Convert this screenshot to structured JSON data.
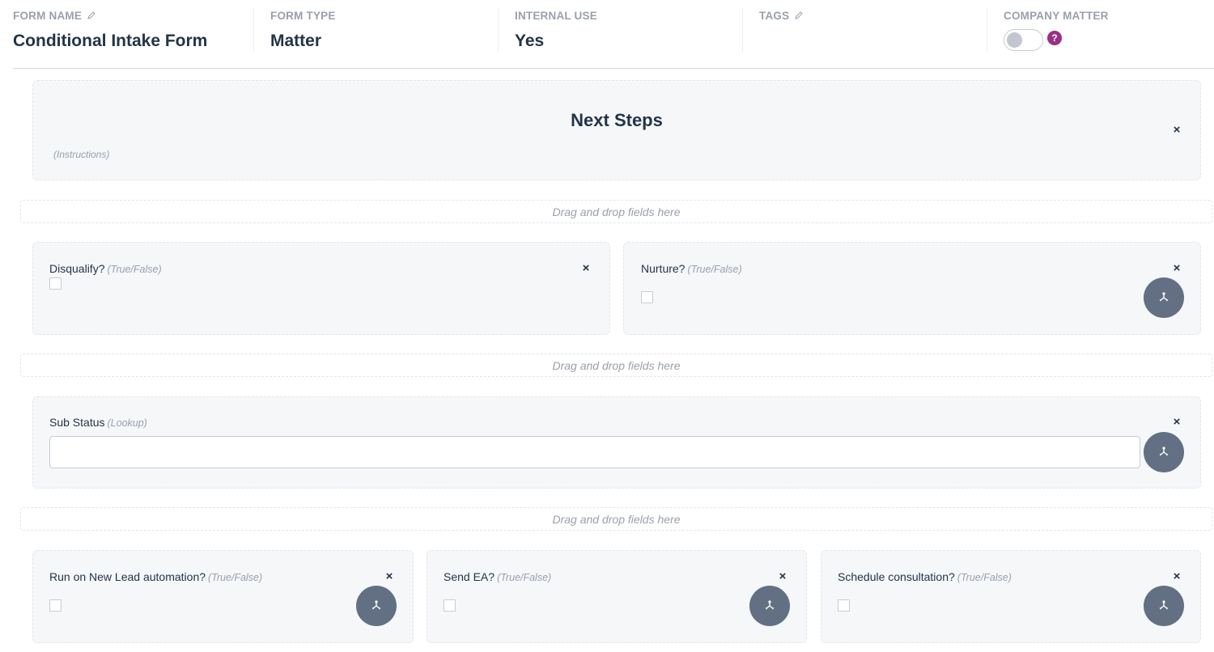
{
  "header": {
    "columns": [
      {
        "label": "FORM NAME",
        "value": "Conditional Intake Form",
        "editable": true
      },
      {
        "label": "FORM TYPE",
        "value": "Matter",
        "editable": false
      },
      {
        "label": "INTERNAL USE",
        "value": "Yes",
        "editable": false
      },
      {
        "label": "TAGS",
        "value": "",
        "editable": true
      },
      {
        "label": "COMPANY MATTER",
        "toggle_on": false,
        "help_icon": "question-circle-icon"
      }
    ],
    "help_symbol": "?"
  },
  "section": {
    "title": "Next Steps",
    "instructions": "(Instructions)",
    "close_symbol": "×"
  },
  "dropzone_text": "Drag and drop fields here",
  "close_symbol": "×",
  "fields": {
    "disqualify": {
      "label": "Disqualify?",
      "type": "(True/False)",
      "checked": false,
      "has_branch": false
    },
    "nurture": {
      "label": "Nurture?",
      "type": "(True/False)",
      "checked": false,
      "has_branch": true
    },
    "sub_status": {
      "label": "Sub Status",
      "type": "(Lookup)",
      "value": "",
      "has_branch": true
    },
    "run_new_lead": {
      "label": "Run on New Lead automation?",
      "type": "(True/False)",
      "checked": false,
      "has_branch": true
    },
    "send_ea": {
      "label": "Send EA?",
      "type": "(True/False)",
      "checked": false,
      "has_branch": true
    },
    "schedule_consultation": {
      "label": "Schedule consultation?",
      "type": "(True/False)",
      "checked": false,
      "has_branch": true
    }
  },
  "colors": {
    "text": "#243447",
    "muted": "#9aa0ab",
    "card_bg": "#f5f7f9",
    "branch_button": "#637083",
    "help_icon": "#9b2f86"
  }
}
